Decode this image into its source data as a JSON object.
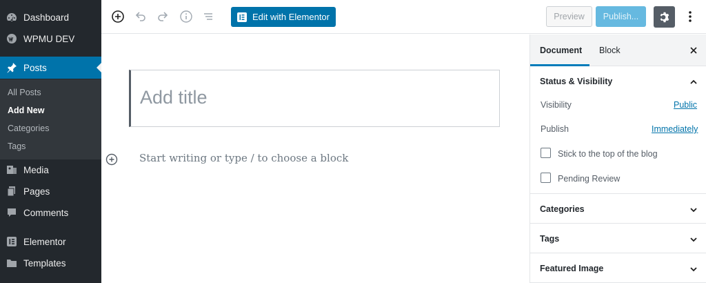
{
  "sidebar": {
    "items": [
      {
        "label": "Dashboard",
        "icon": "dashboard-icon"
      },
      {
        "label": "WPMU DEV",
        "icon": "wpmudev-icon"
      },
      {
        "label": "Posts",
        "icon": "pin-icon"
      },
      {
        "label": "Media",
        "icon": "media-icon"
      },
      {
        "label": "Pages",
        "icon": "pages-icon"
      },
      {
        "label": "Comments",
        "icon": "comments-icon"
      },
      {
        "label": "Elementor",
        "icon": "elementor-icon"
      },
      {
        "label": "Templates",
        "icon": "folder-icon"
      }
    ],
    "submenu": [
      "All Posts",
      "Add New",
      "Categories",
      "Tags"
    ],
    "active_item": "Posts",
    "current_subitem": "Add New"
  },
  "toolbar": {
    "elementor_label": "Edit with Elementor",
    "preview_label": "Preview",
    "publish_label": "Publish..."
  },
  "editor": {
    "title_placeholder": "Add title",
    "block_placeholder": "Start writing or type / to choose a block"
  },
  "panel": {
    "tabs": [
      "Document",
      "Block"
    ],
    "status_title": "Status & Visibility",
    "visibility_label": "Visibility",
    "visibility_value": "Public",
    "publish_label": "Publish",
    "publish_value": "Immediately",
    "checkbox1": "Stick to the top of the blog",
    "checkbox2": "Pending Review",
    "sections": [
      "Categories",
      "Tags",
      "Featured Image"
    ]
  },
  "colors": {
    "accent": "#0073aa",
    "sidebar_bg": "#23282d"
  }
}
